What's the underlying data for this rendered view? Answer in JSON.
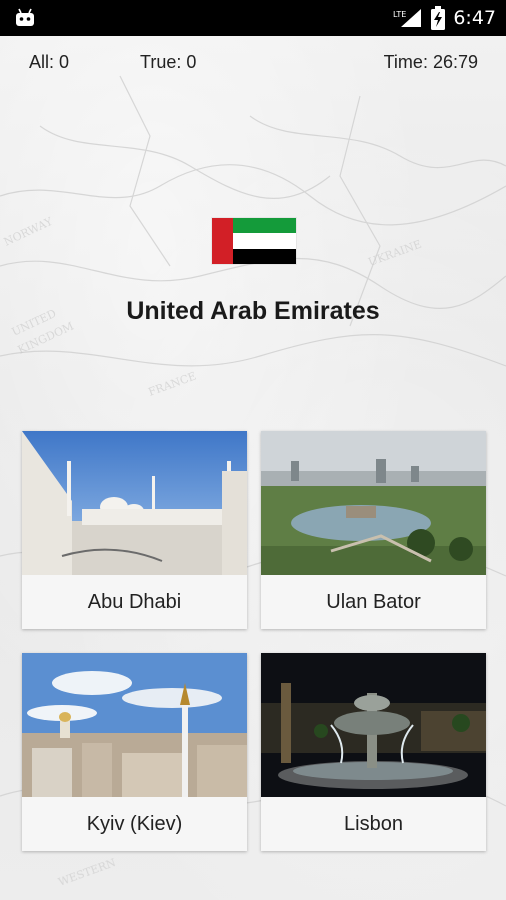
{
  "status_bar": {
    "time": "6:47",
    "network": "LTE",
    "icons": [
      "android-icon",
      "lte-signal-icon",
      "battery-charging-icon"
    ]
  },
  "stats": {
    "all": "All: 0",
    "true": "True: 0",
    "time": "Time: 26:79"
  },
  "question": {
    "country": "United Arab Emirates",
    "flag": {
      "colors": {
        "red": "#d21f26",
        "green": "#149b3a",
        "white": "#ffffff",
        "black": "#000000"
      }
    }
  },
  "options": [
    {
      "label": "Abu Dhabi"
    },
    {
      "label": "Ulan Bator"
    },
    {
      "label": "Kyiv (Kiev)"
    },
    {
      "label": "Lisbon"
    }
  ]
}
